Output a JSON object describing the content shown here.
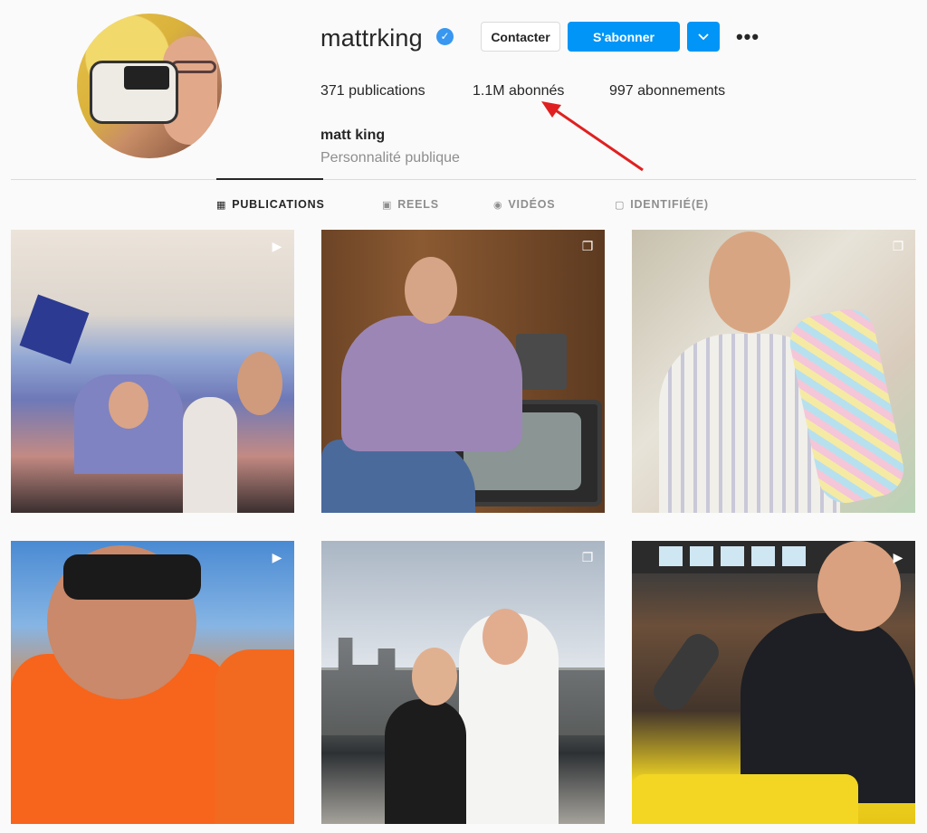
{
  "profile": {
    "username": "mattrking",
    "verified_symbol": "✓",
    "full_name": "matt king",
    "category": "Personnalité publique"
  },
  "actions": {
    "contact_label": "Contacter",
    "follow_label": "S'abonner",
    "more_follow_icon": "chevron-down-icon",
    "options_label": "•••"
  },
  "stats": {
    "posts": "371 publications",
    "followers": "1.1M abonnés",
    "following": "997 abonnements"
  },
  "annotation": {
    "arrow_color": "#e02020"
  },
  "tabs": [
    {
      "label": "PUBLICATIONS",
      "icon": "grid-icon",
      "glyph": "▦",
      "active": true
    },
    {
      "label": "REELS",
      "icon": "reels-icon",
      "glyph": "▣",
      "active": false
    },
    {
      "label": "VIDÉOS",
      "icon": "video-icon",
      "glyph": "◉",
      "active": false
    },
    {
      "label": "IDENTIFIÉ(E)",
      "icon": "tagged-icon",
      "glyph": "▢",
      "active": false
    }
  ],
  "posts": [
    {
      "badge": "reel-icon",
      "glyph": "▶"
    },
    {
      "badge": "carousel-icon",
      "glyph": "❐"
    },
    {
      "badge": "carousel-icon",
      "glyph": "❐"
    },
    {
      "badge": "reel-icon",
      "glyph": "▶"
    },
    {
      "badge": "carousel-icon",
      "glyph": "❐"
    },
    {
      "badge": "reel-icon",
      "glyph": "▶"
    }
  ],
  "colors": {
    "accent": "#0095f6",
    "verified": "#3897f0",
    "text": "#262626",
    "muted": "#8e8e8e"
  }
}
